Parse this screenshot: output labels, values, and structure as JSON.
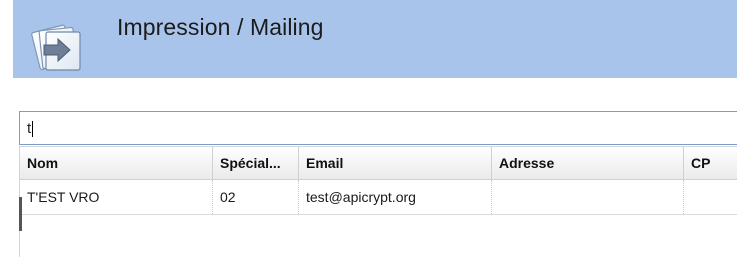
{
  "header": {
    "title": "Impression / Mailing",
    "icon": "documents-arrow-icon",
    "background": "#a9c4eb"
  },
  "search": {
    "value": "t"
  },
  "table": {
    "columns": [
      "Nom",
      "Spécial...",
      "Email",
      "Adresse",
      "CP"
    ],
    "rows": [
      [
        "T'EST VRO",
        "02",
        "test@apicrypt.org",
        "",
        ""
      ]
    ]
  }
}
